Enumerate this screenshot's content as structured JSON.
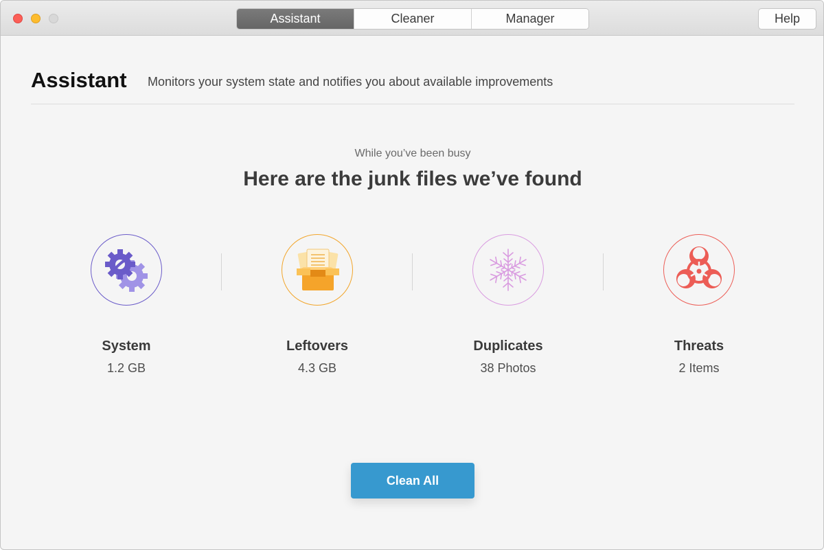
{
  "titlebar": {
    "tabs": [
      {
        "label": "Assistant",
        "active": true
      },
      {
        "label": "Cleaner",
        "active": false
      },
      {
        "label": "Manager",
        "active": false
      }
    ],
    "help_label": "Help"
  },
  "header": {
    "title": "Assistant",
    "subtitle": "Monitors your system state and notifies you about available improvements"
  },
  "main": {
    "eyebrow": "While you’ve been busy",
    "headline": "Here are the junk files we’ve found",
    "categories": [
      {
        "name": "System",
        "value": "1.2 GB",
        "icon": "gears-icon",
        "color": "#6a5bc9"
      },
      {
        "name": "Leftovers",
        "value": "4.3 GB",
        "icon": "box-documents-icon",
        "color": "#f2a52a"
      },
      {
        "name": "Duplicates",
        "value": "38 Photos",
        "icon": "snowflake-icon",
        "color": "#d99be0"
      },
      {
        "name": "Threats",
        "value": "2 Items",
        "icon": "biohazard-icon",
        "color": "#ec5d56"
      }
    ],
    "clean_all_label": "Clean All",
    "accent_color": "#3799cf"
  }
}
